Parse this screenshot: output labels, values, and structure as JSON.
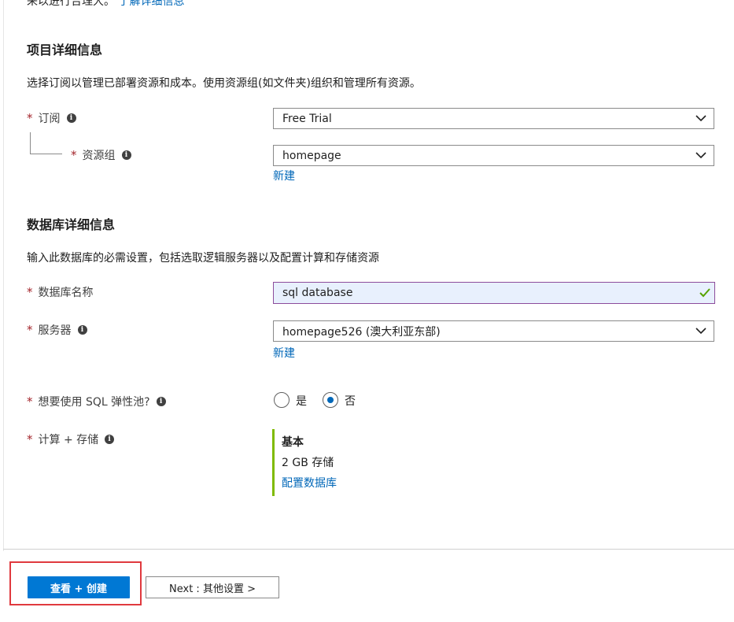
{
  "top_partial": {
    "text": "来以进行合理大。",
    "link": "了解详细信息"
  },
  "project": {
    "title": "项目详细信息",
    "description": "选择订阅以管理已部署资源和成本。使用资源组(如文件夹)组织和管理所有资源。",
    "subscription": {
      "label": "订阅",
      "value": "Free Trial",
      "required": "*"
    },
    "resource_group": {
      "label": "资源组",
      "value": "homepage",
      "required": "*",
      "new_link": "新建"
    }
  },
  "database": {
    "title": "数据库详细信息",
    "description": "输入此数据库的必需设置，包括选取逻辑服务器以及配置计算和存储资源",
    "name": {
      "label": "数据库名称",
      "value": "sql database",
      "required": "*"
    },
    "server": {
      "label": "服务器",
      "value": "homepage526 (澳大利亚东部)",
      "required": "*",
      "new_link": "新建"
    },
    "elastic_pool": {
      "label": "想要使用 SQL 弹性池?",
      "required": "*",
      "options": [
        "是",
        "否"
      ],
      "selected": "否"
    },
    "compute": {
      "label": "计算 + 存储",
      "required": "*",
      "tier": "基本",
      "storage": "2 GB 存储",
      "configure_link": "配置数据库"
    }
  },
  "footer": {
    "review_button": "查看 + 创建",
    "next_button": "Next : 其他设置 >"
  },
  "colors": {
    "accent": "#0078d4",
    "link": "#0067b8",
    "required": "#a4262c",
    "valid": "#57a300",
    "summary_bar": "#7fba00",
    "highlight": "#e0393e"
  },
  "icons": {
    "info": "info-icon",
    "chevron": "chevron-down-icon",
    "check": "checkmark-icon"
  }
}
